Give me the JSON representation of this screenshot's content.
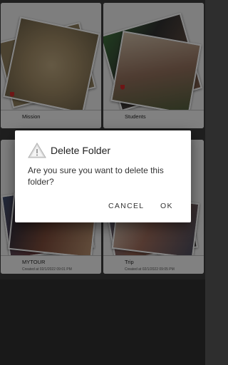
{
  "folders": [
    {
      "name": "Mission",
      "date": ""
    },
    {
      "name": "Students",
      "date": ""
    },
    {
      "name": "MYTOUR",
      "date": "Created at 02/1/2022 09:01 PM"
    },
    {
      "name": "Trip",
      "date": "Created at 02/1/2022 09:05 PM"
    }
  ],
  "dialog": {
    "title": "Delete Folder",
    "message": "Are you sure you want to delete this folder?",
    "cancel_label": "CANCEL",
    "ok_label": "OK",
    "icon": "warning-icon"
  },
  "colors": {
    "background": "#2e2e2e",
    "card": "#e9e9e9",
    "dialog": "#ffffff",
    "tag": "#c62828"
  }
}
